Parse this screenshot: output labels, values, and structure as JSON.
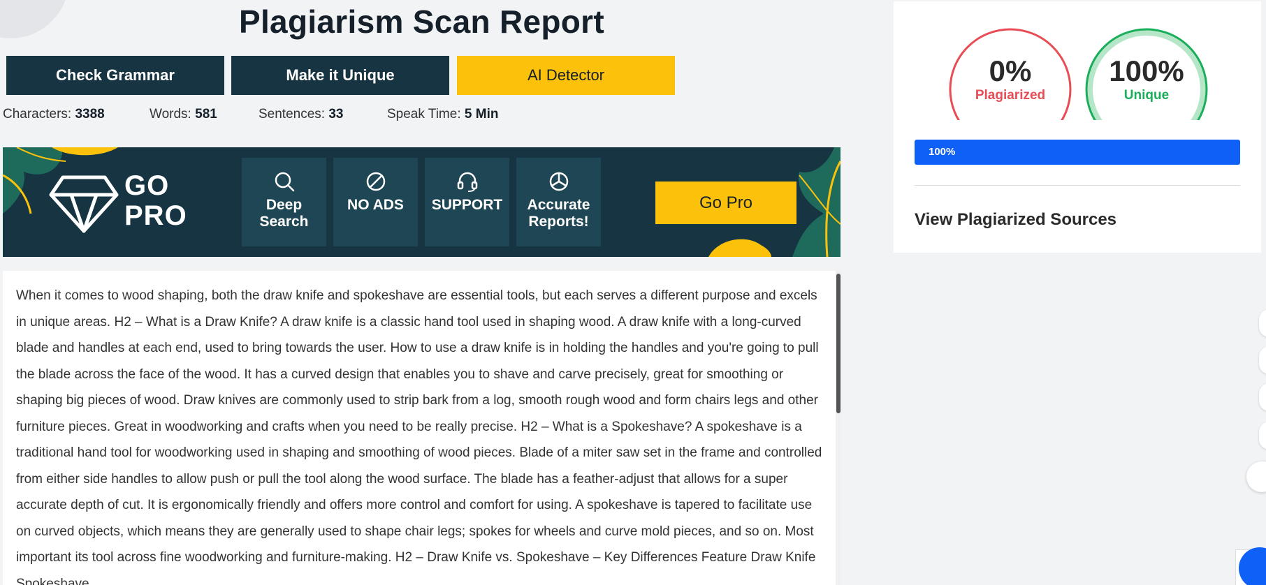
{
  "page": {
    "title": "Plagiarism Scan Report"
  },
  "actions": {
    "check_grammar": "Check Grammar",
    "make_unique": "Make it Unique",
    "ai_detector": "AI Detector"
  },
  "stats": {
    "characters_label": "Characters:",
    "characters_value": "3388",
    "words_label": "Words:",
    "words_value": "581",
    "sentences_label": "Sentences:",
    "sentences_value": "33",
    "speak_label": "Speak Time:",
    "speak_value": "5 Min"
  },
  "banner": {
    "go": "GO",
    "pro": "PRO",
    "features": [
      {
        "label": "Deep Search",
        "icon": "search-icon"
      },
      {
        "label": "NO ADS",
        "icon": "no-ads-icon"
      },
      {
        "label": "SUPPORT",
        "icon": "headset-icon"
      },
      {
        "label": "Accurate Reports!",
        "icon": "pie-chart-icon"
      }
    ],
    "cta": "Go Pro"
  },
  "content": {
    "text": "When it comes to wood shaping, both the draw knife and spokeshave are essential tools, but each serves a different purpose and excels in unique areas. H2 – What is a Draw Knife? A draw knife is a classic hand tool used in shaping wood. A draw knife with a long-curved blade and handles at each end, used to bring towards the user. How to use a draw knife is in holding the handles and you're going to pull the blade across the face of the wood. It has a curved design that enables you to shave and carve precisely, great for smoothing or shaping big pieces of wood. Draw knives are commonly used to strip bark from a log, smooth rough wood and form chairs legs and other furniture pieces. Great in woodworking and crafts when you need to be really precise. H2 – What is a Spokeshave? A spokeshave is a traditional hand tool for woodworking used in shaping and smoothing of wood pieces. Blade of a miter saw set in the frame and controlled from either side handles to allow push or pull the tool along the wood surface. The blade has a feather-adjust that allows for a super accurate depth of cut. It is ergonomically friendly and offers more control and comfort for using. A spokeshave is tapered to facilitate use on curved objects, which means they are generally used to shape chair legs; spokes for wheels and curve mold pieces, and so on. Most important its tool across fine woodworking and furniture-making. H2 – Draw Knife vs. Spokeshave – Key Differences Feature Draw Knife Spokeshave"
  },
  "results": {
    "plagiarized_value": "0%",
    "plagiarized_label": "Plagiarized",
    "unique_value": "100%",
    "unique_label": "Unique",
    "progress_text": "100%",
    "progress_fraction": 1.0,
    "sources_title": "View Plagiarized Sources"
  },
  "colors": {
    "dark_teal": "#163442",
    "yellow": "#fcc20b",
    "plagiarized_red": "#e84c55",
    "unique_green": "#1aae5a",
    "progress_blue": "#0e60f7"
  }
}
